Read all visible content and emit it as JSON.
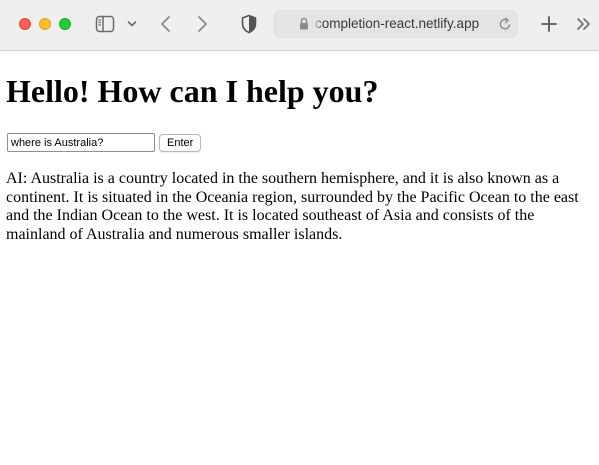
{
  "browser": {
    "url": "completion-react.netlify.app",
    "icons": {
      "close": "close-traffic-light",
      "minimize": "minimize-traffic-light",
      "maximize": "maximize-traffic-light",
      "sidebar": "sidebar-icon",
      "tab_overview": "chevron-down-icon",
      "back": "back-arrow-icon",
      "forward": "forward-arrow-icon",
      "privacy": "shield-icon",
      "secure": "lock-icon",
      "reload": "reload-icon",
      "new_tab": "plus-icon",
      "overflow": "double-chevron-icon"
    },
    "colors": {
      "close": "#fe5f57",
      "minimize": "#febc2e",
      "maximize": "#28c840",
      "toolbar_bg": "#efefef"
    }
  },
  "page": {
    "heading": "Hello! How can I help you?",
    "prompt_input": {
      "value": "where is Australia?",
      "placeholder": ""
    },
    "enter_button_label": "Enter",
    "response": "AI: Australia is a country located in the southern hemisphere, and it is also known as a continent. It is situated in the Oceania region, surrounded by the Pacific Ocean to the east and the Indian Ocean to the west. It is located southeast of Asia and consists of the mainland of Australia and numerous smaller islands."
  }
}
